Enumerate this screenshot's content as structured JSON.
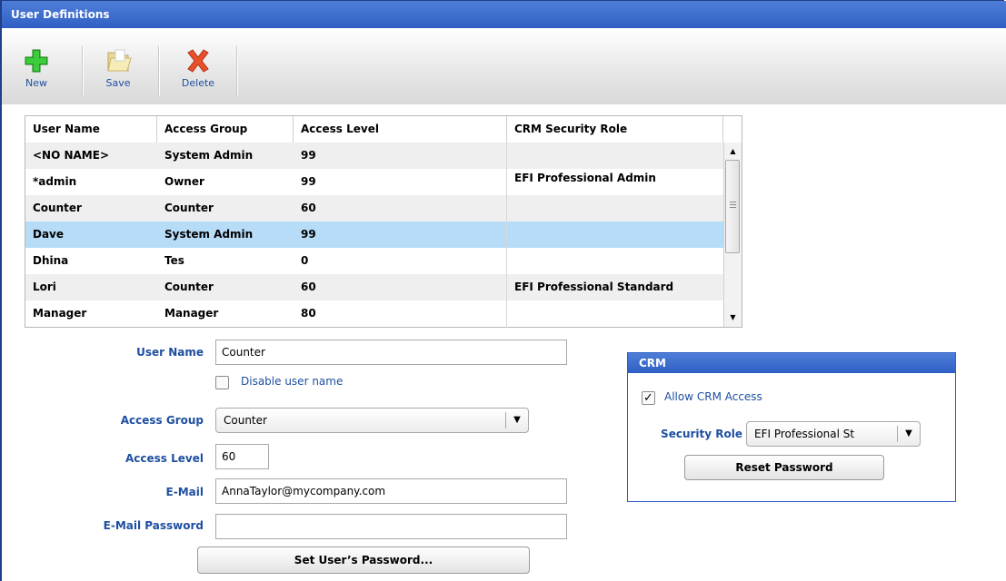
{
  "window": {
    "title": "User Definitions"
  },
  "toolbar": {
    "new_label": "New",
    "save_label": "Save",
    "delete_label": "Delete"
  },
  "grid": {
    "columns": [
      "User Name",
      "Access Group",
      "Access Level",
      "CRM Security Role"
    ],
    "rows": [
      {
        "user": "<NO NAME>",
        "group": "System Admin",
        "level": "99",
        "role": ""
      },
      {
        "user": "*admin",
        "group": "Owner",
        "level": "99",
        "role": "EFI Professional Admin"
      },
      {
        "user": "Counter",
        "group": "Counter",
        "level": "60",
        "role": ""
      },
      {
        "user": "Dave",
        "group": "System Admin",
        "level": "99",
        "role": ""
      },
      {
        "user": "Dhina",
        "group": "Tes",
        "level": "0",
        "role": ""
      },
      {
        "user": "Lori",
        "group": "Counter",
        "level": "60",
        "role": "EFI Professional Standard"
      },
      {
        "user": "Manager",
        "group": "Manager",
        "level": "80",
        "role": ""
      }
    ],
    "selected_row": "Dave"
  },
  "form": {
    "user_name_label": "User Name",
    "user_name_value": "Counter",
    "disable_label": "Disable user name",
    "access_group_label": "Access Group",
    "access_group_value": "Counter",
    "access_level_label": "Access Level",
    "access_level_value": "60",
    "email_label": "E-Mail",
    "email_value": "AnnaTaylor@mycompany.com",
    "email_password_label": "E-Mail Password",
    "email_password_value": "",
    "set_password_label": "Set User’s Password..."
  },
  "crm": {
    "title": "CRM",
    "allow_label": "Allow CRM Access",
    "allow_checked": true,
    "security_role_label": "Security Role",
    "security_role_value": "EFI Professional St",
    "reset_label": "Reset Password"
  },
  "colors": {
    "title_bar": "#2f5fc4",
    "label_blue": "#1e4fa0",
    "selected_row": "#b7dcf7"
  }
}
